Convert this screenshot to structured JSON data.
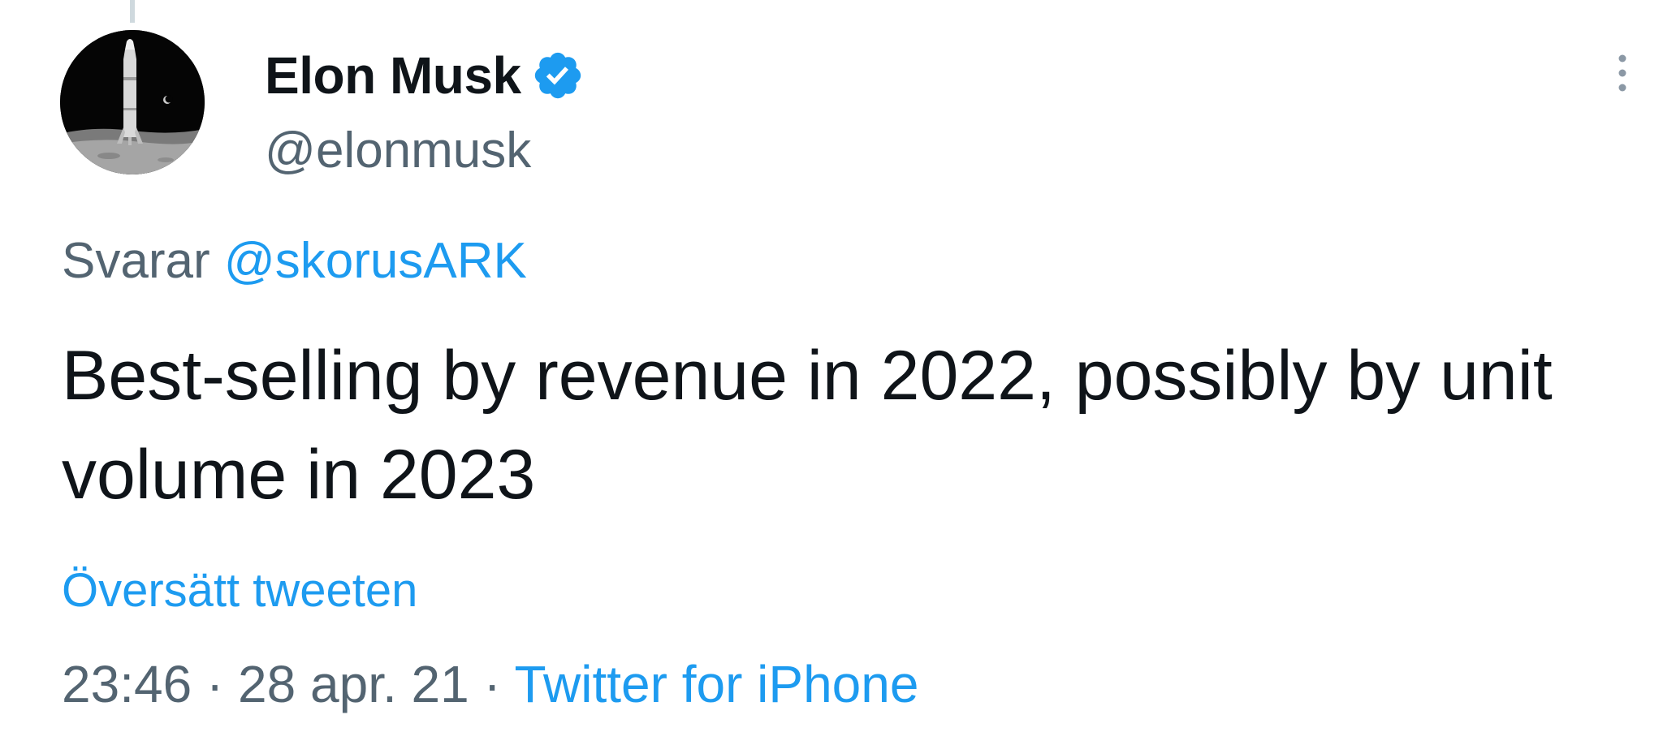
{
  "tweet": {
    "author": {
      "name": "Elon Musk",
      "handle": "@elonmusk",
      "verified": true
    },
    "reply": {
      "prefix": "Svarar",
      "to_handle": "@skorusARK"
    },
    "text": "Best-selling by revenue in 2022, possibly by unit volume in 2023",
    "translate_label": "Översätt tweeten",
    "meta": {
      "time": "23:46",
      "separator": " · ",
      "date": "28 apr. 21",
      "source": "Twitter for iPhone"
    }
  },
  "icons": {
    "verified": "verified-badge-icon",
    "more": "more-vertical-icon"
  },
  "colors": {
    "primary_text": "#0f1419",
    "secondary_text": "#536471",
    "link": "#1d9bf0",
    "verified": "#1d9bf0"
  }
}
